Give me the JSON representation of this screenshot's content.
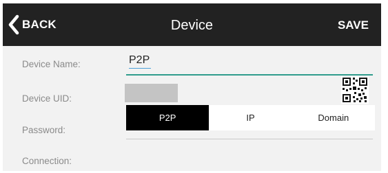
{
  "header": {
    "back_label": "BACK",
    "title": "Device",
    "save_label": "SAVE"
  },
  "form": {
    "device_name": {
      "label": "Device Name:",
      "value": "P2P"
    },
    "device_uid": {
      "label": "Device UID:",
      "value": ""
    },
    "password": {
      "label": "Password:",
      "value": "••••••"
    },
    "connection": {
      "label": "Connection:",
      "options": [
        "P2P",
        "IP",
        "Domain"
      ],
      "selected": "P2P"
    }
  },
  "colors": {
    "header_bg": "#222222",
    "accent": "#2f9c8c",
    "selected_segment": "#000000"
  },
  "icons": {
    "back": "chevron-left-icon",
    "scan": "qr-code-icon"
  }
}
